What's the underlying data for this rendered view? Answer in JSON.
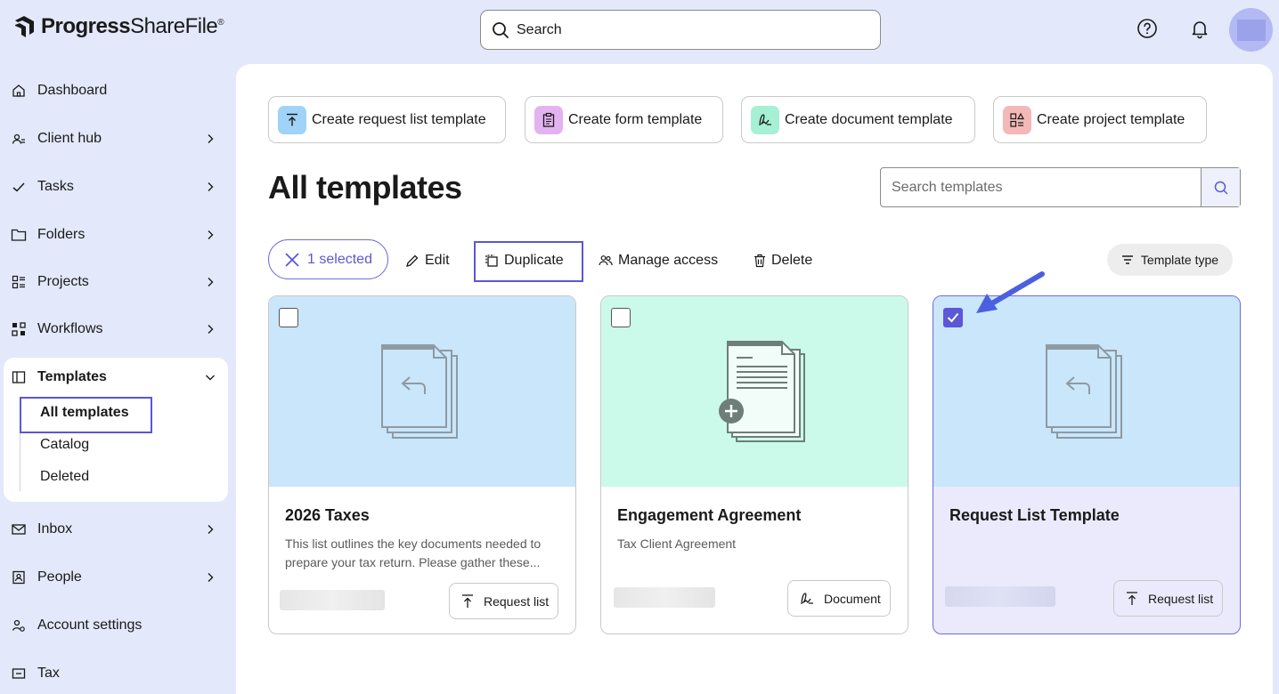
{
  "app": {
    "brand_main": "Progress",
    "brand_product": "ShareFile",
    "brand_mark": "®"
  },
  "header": {
    "search_label": "Search",
    "help_icon": "help-circle-icon",
    "bell_icon": "bell-icon"
  },
  "sidebar": {
    "items": [
      {
        "label": "Dashboard",
        "icon": "home-icon"
      },
      {
        "label": "Client hub",
        "icon": "client-hub-icon"
      },
      {
        "label": "Tasks",
        "icon": "check-icon"
      },
      {
        "label": "Folders",
        "icon": "folder-icon"
      },
      {
        "label": "Projects",
        "icon": "projects-icon"
      },
      {
        "label": "Workflows",
        "icon": "workflows-icon"
      },
      {
        "label": "Templates",
        "icon": "templates-icon"
      },
      {
        "label": "Inbox",
        "icon": "mail-icon"
      },
      {
        "label": "People",
        "icon": "people-icon"
      },
      {
        "label": "Account settings",
        "icon": "account-settings-icon"
      },
      {
        "label": "Tax",
        "icon": "tax-icon"
      }
    ],
    "templates_sub": [
      "All templates",
      "Catalog",
      "Deleted"
    ]
  },
  "create_buttons": [
    {
      "label": "Create request list template",
      "color": "#9fd3f7"
    },
    {
      "label": "Create form template",
      "color": "#e3b2f0"
    },
    {
      "label": "Create document template",
      "color": "#a6f0d6"
    },
    {
      "label": "Create project template",
      "color": "#f4b8b8"
    }
  ],
  "page": {
    "title": "All templates",
    "search_placeholder": "Search templates"
  },
  "toolbar": {
    "selected": "1 selected",
    "edit": "Edit",
    "duplicate": "Duplicate",
    "manage_access": "Manage access",
    "delete": "Delete",
    "template_type": "Template type"
  },
  "cards": [
    {
      "title": "2026 Taxes",
      "description": "This list outlines the key documents needed to prepare your tax return. Please gather these...",
      "type": "Request list",
      "checked": false,
      "hero_color": "#c9e6fb"
    },
    {
      "title": "Engagement Agreement",
      "description": "Tax Client Agreement",
      "type": "Document",
      "checked": false,
      "hero_color": "#cbfaea"
    },
    {
      "title": "Request List Template",
      "description": "",
      "type": "Request list",
      "checked": true,
      "hero_color": "#c9e6fb"
    }
  ],
  "colors": {
    "accent": "#5b57d6",
    "background": "#e3e8fa"
  }
}
